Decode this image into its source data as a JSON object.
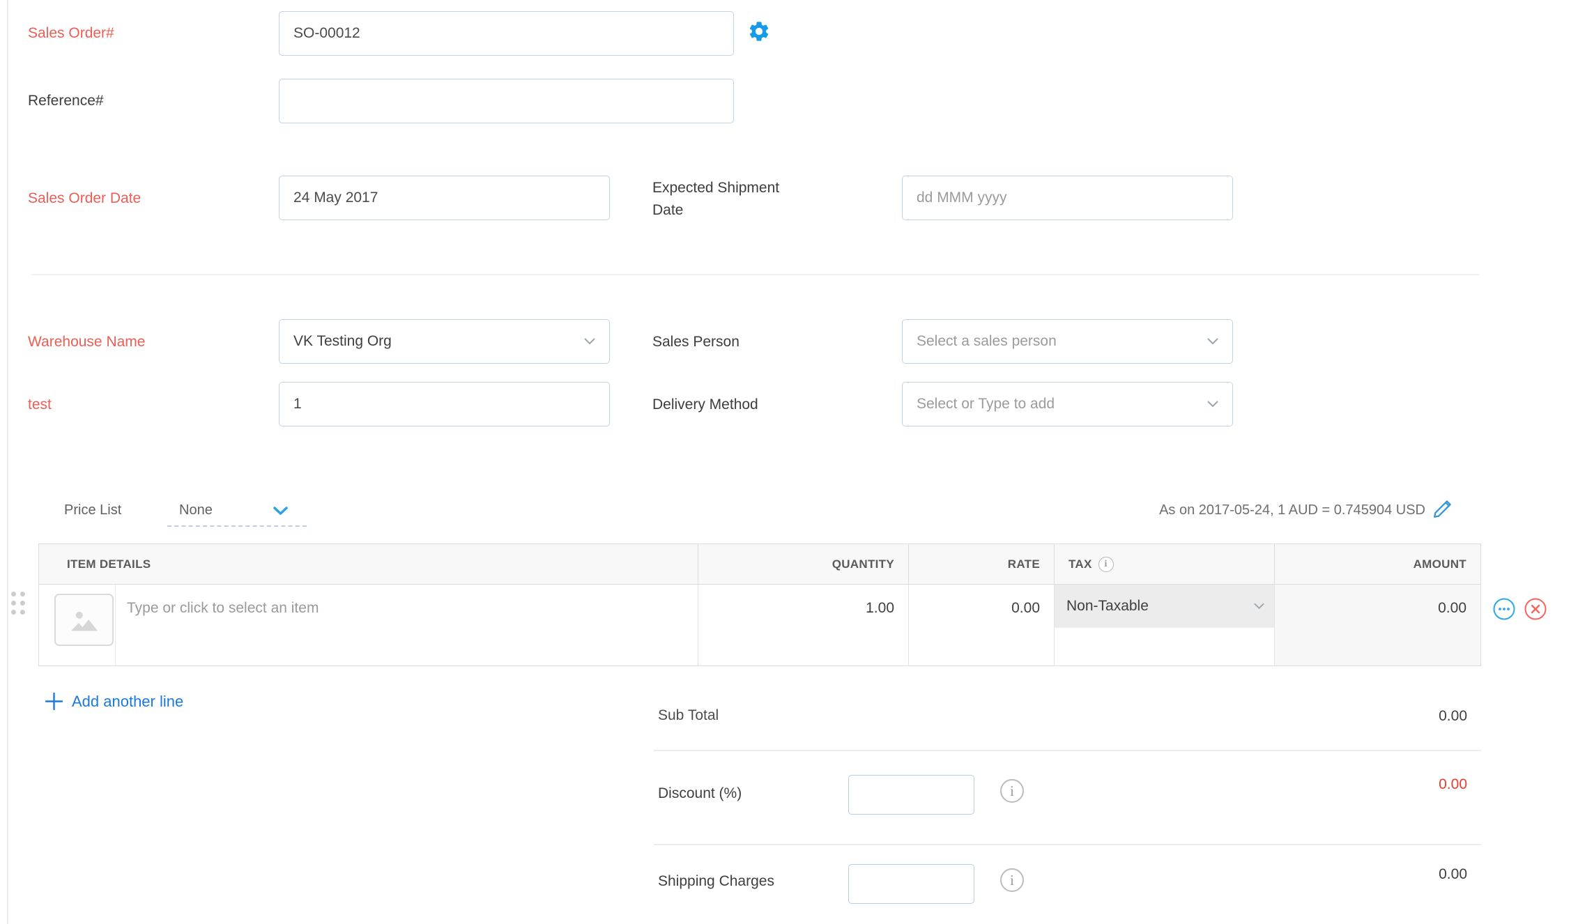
{
  "colors": {
    "required_red": "#ec5e55",
    "accent_blue": "#169ce6",
    "link_blue": "#1c7ad9",
    "value_red": "#e73c33",
    "row_action_blue": "#2ba7e8",
    "row_action_red": "#f4655f"
  },
  "fields": {
    "sales_order_no": {
      "label": "Sales Order#",
      "value": "SO-00012"
    },
    "reference_no": {
      "label": "Reference#",
      "value": ""
    },
    "sales_order_date": {
      "label": "Sales Order Date",
      "value": "24 May 2017"
    },
    "expected_shipment_date": {
      "label_line1": "Expected Shipment",
      "label_line2": "Date",
      "placeholder": "dd MMM yyyy"
    },
    "warehouse_name": {
      "label": "Warehouse Name",
      "value": "VK Testing Org"
    },
    "sales_person": {
      "label": "Sales Person",
      "placeholder": "Select a sales person"
    },
    "test": {
      "label": "test",
      "value": "1"
    },
    "delivery_method": {
      "label": "Delivery Method",
      "placeholder": "Select or Type to add"
    }
  },
  "price_list": {
    "label": "Price List",
    "value": "None"
  },
  "exchange_rate_note": "As on 2017-05-24, 1 AUD = 0.745904 USD",
  "items_table": {
    "headers": {
      "item_details": "ITEM DETAILS",
      "quantity": "QUANTITY",
      "rate": "RATE",
      "tax": "TAX",
      "amount": "AMOUNT"
    },
    "row": {
      "item_placeholder": "Type or click to select an item",
      "quantity": "1.00",
      "rate": "0.00",
      "tax": "Non-Taxable",
      "amount": "0.00"
    }
  },
  "add_another_line": "Add another line",
  "summary": {
    "sub_total": {
      "label": "Sub Total",
      "value": "0.00"
    },
    "discount": {
      "label": "Discount (%)",
      "input_value": "",
      "value": "0.00"
    },
    "shipping_charges": {
      "label": "Shipping Charges",
      "input_value": "",
      "value": "0.00"
    }
  },
  "info_glyph": "i"
}
